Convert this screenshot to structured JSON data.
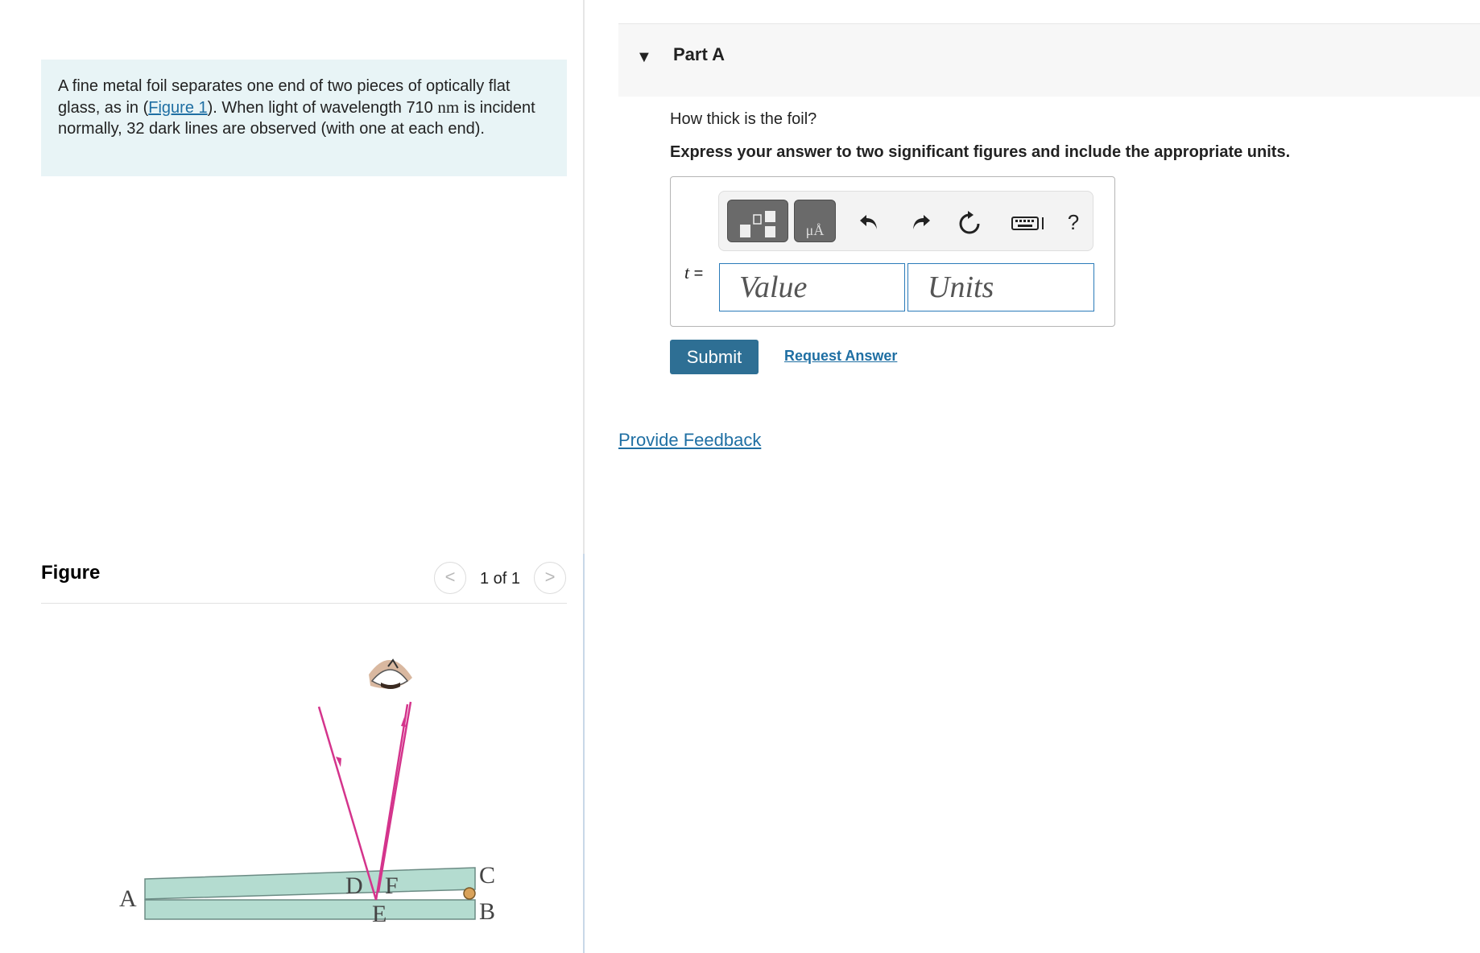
{
  "problem": {
    "text_before": "A fine metal foil separates one end of two pieces of optically flat glass, as in (",
    "figure_link": "Figure 1",
    "text_mid": "). When light of wavelength 710 ",
    "unit": "nm",
    "text_after": " is incident normally, 32 dark lines are observed (with one at each end)."
  },
  "figure": {
    "title": "Figure",
    "prev_label": "<",
    "next_label": ">",
    "counter": "1 of 1",
    "labels": {
      "A": "A",
      "B": "B",
      "C": "C",
      "D": "D",
      "E": "E",
      "F": "F"
    }
  },
  "part": {
    "caret": "▼",
    "title": "Part A",
    "question": "How thick is the foil?",
    "instruction": "Express your answer to two significant figures and include the appropriate units.",
    "variable": "t",
    "equals": " =",
    "value_placeholder": "Value",
    "units_placeholder": "Units",
    "units_button_text": "μÅ",
    "help_label": "?",
    "submit_label": "Submit",
    "request_label": "Request Answer"
  },
  "footer": {
    "feedback_label": "Provide Feedback"
  },
  "icons": [
    "caret-down-icon",
    "templates-icon",
    "units-icon",
    "undo-icon",
    "redo-icon",
    "reset-icon",
    "keyboard-icon",
    "help-icon",
    "chevron-left-icon",
    "chevron-right-icon"
  ],
  "colors": {
    "link": "#1f6fa3",
    "submit_bg": "#2e6f94",
    "intro_bg": "#e8f4f6",
    "glass": "#b4dcd0",
    "ray": "#d4348c",
    "foil": "#d9a25a"
  }
}
